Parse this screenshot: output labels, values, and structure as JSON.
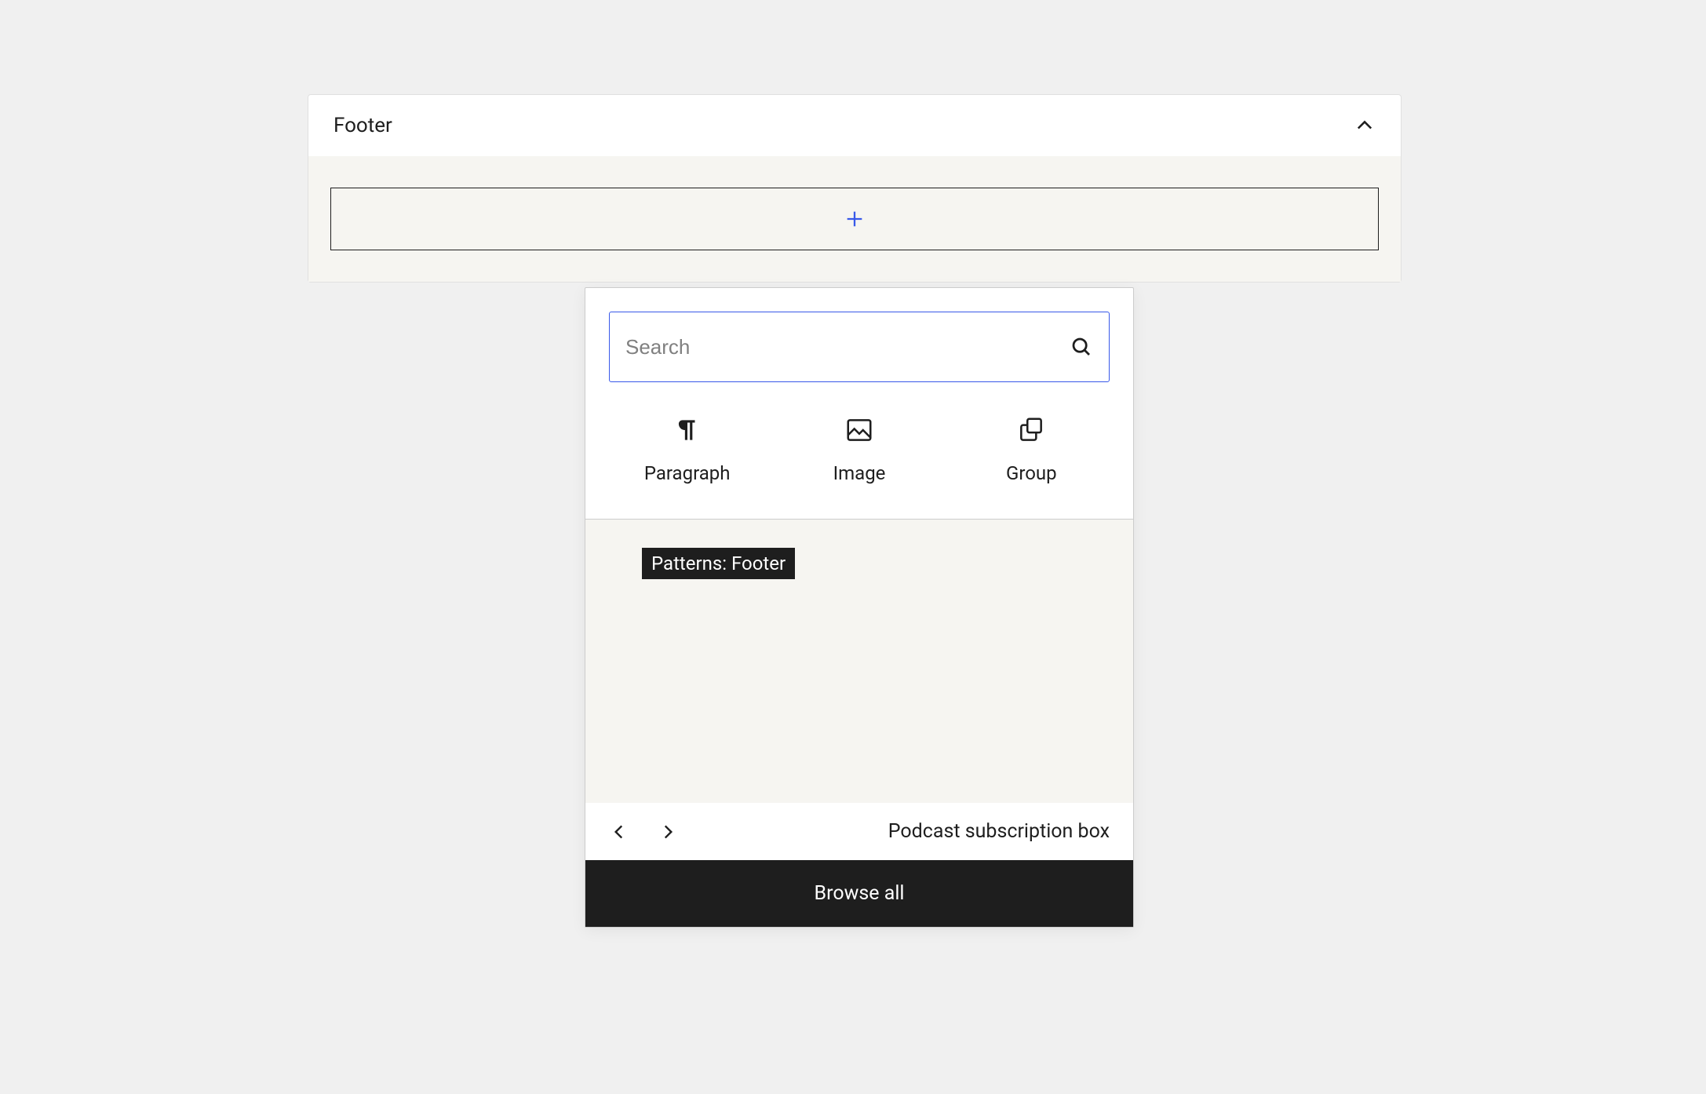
{
  "panel": {
    "title": "Footer"
  },
  "inserter": {
    "search": {
      "placeholder": "Search"
    },
    "blocks": [
      {
        "label": "Paragraph"
      },
      {
        "label": "Image"
      },
      {
        "label": "Group"
      }
    ],
    "patterns": {
      "badge": "Patterns: Footer",
      "current": "Podcast subscription box"
    },
    "browse_all": "Browse all"
  }
}
